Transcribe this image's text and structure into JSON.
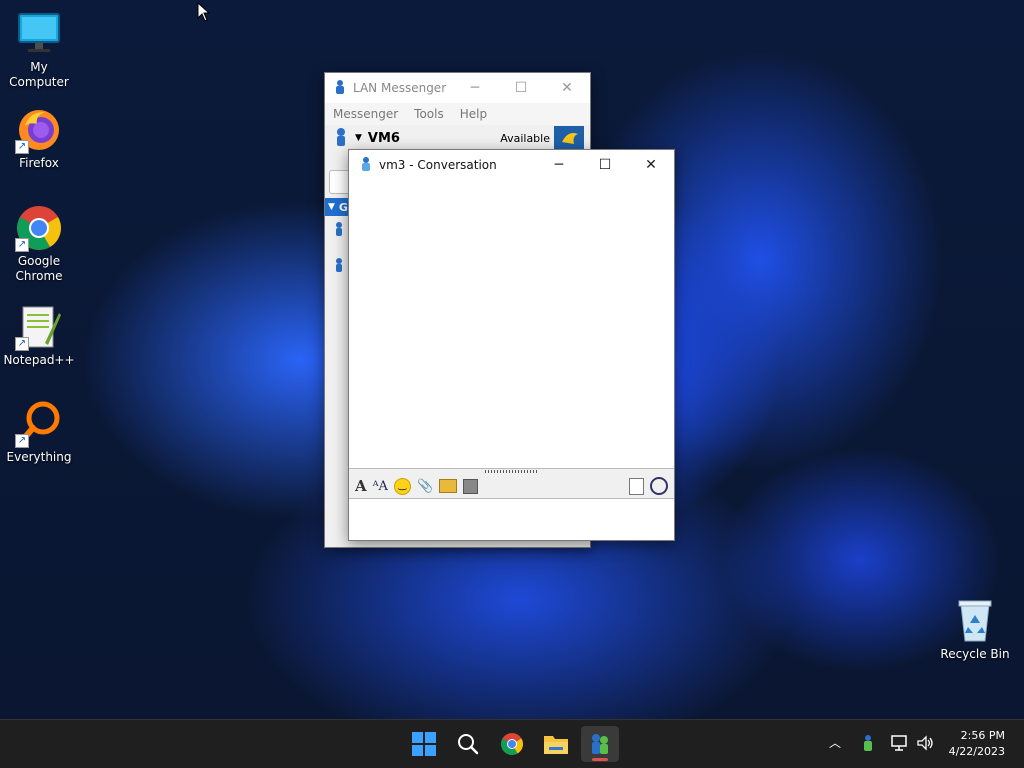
{
  "desktop": {
    "icons": [
      {
        "label": "My Computer"
      },
      {
        "label": "Firefox"
      },
      {
        "label": "Google Chrome"
      },
      {
        "label": "Notepad++"
      },
      {
        "label": "Everything"
      },
      {
        "label": "Recycle Bin"
      }
    ]
  },
  "lan_messenger": {
    "title": "LAN Messenger",
    "menu": [
      "Messenger",
      "Tools",
      "Help"
    ],
    "user_name": "VM6",
    "status": "Available",
    "group_initial": "G"
  },
  "conversation": {
    "title": "vm3 - Conversation"
  },
  "taskbar": {
    "time": "2:56 PM",
    "date": "4/22/2023"
  },
  "colors": {
    "accent": "#0078d4",
    "group_header": "#1e6fd0"
  }
}
